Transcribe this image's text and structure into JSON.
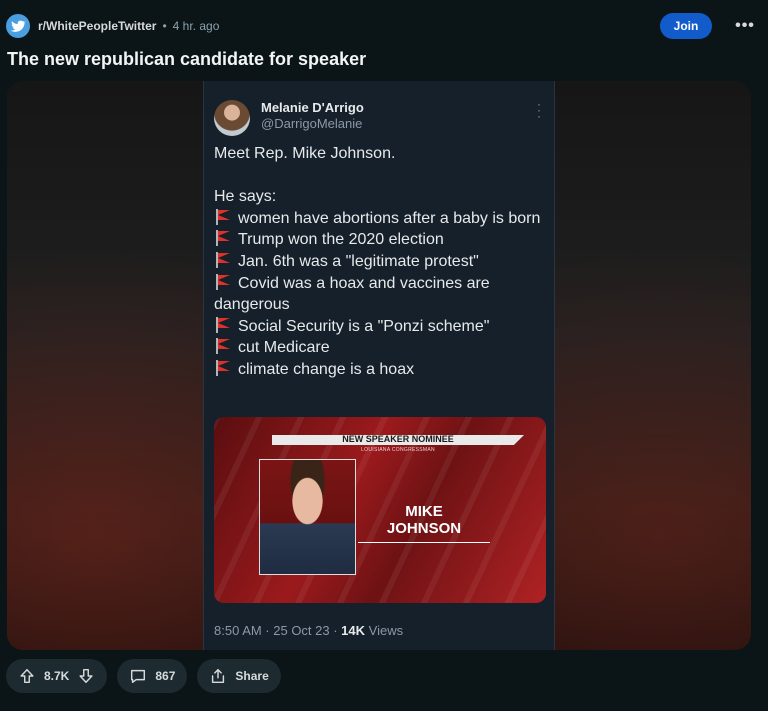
{
  "post": {
    "subreddit": "r/WhitePeopleTwitter",
    "separator": "•",
    "time": "4 hr. ago",
    "join_label": "Join",
    "more_label": "•••",
    "title": "The new republican candidate for speaker"
  },
  "tweet": {
    "name": "Melanie D'Arrigo",
    "handle": "@DarrigoMelanie",
    "intro": "Meet Rep. Mike Johnson.",
    "says": "He says:",
    "points": [
      "women have abortions after a baby is born",
      "Trump won the 2020 election",
      "Jan. 6th was a \"legitimate protest\"",
      "Covid was a hoax and vaccines are dangerous",
      "Social Security is a \"Ponzi scheme\"",
      "cut Medicare",
      "climate change is a hoax"
    ],
    "image": {
      "banner": "NEW SPEAKER NOMINEE",
      "subtitle": "LOUISIANA CONGRESSMAN",
      "name_line1": "MIKE",
      "name_line2": "JOHNSON"
    },
    "time": "8:50 AM · 25 Oct 23 · ",
    "views_count": "14K",
    "views_label": " Views"
  },
  "actions": {
    "votes": "8.7K",
    "comments": "867",
    "share": "Share"
  },
  "colors": {
    "background": "#0b1416",
    "join": "#115bca",
    "tweet_bg": "#15202b",
    "flag": "#e0302c"
  }
}
